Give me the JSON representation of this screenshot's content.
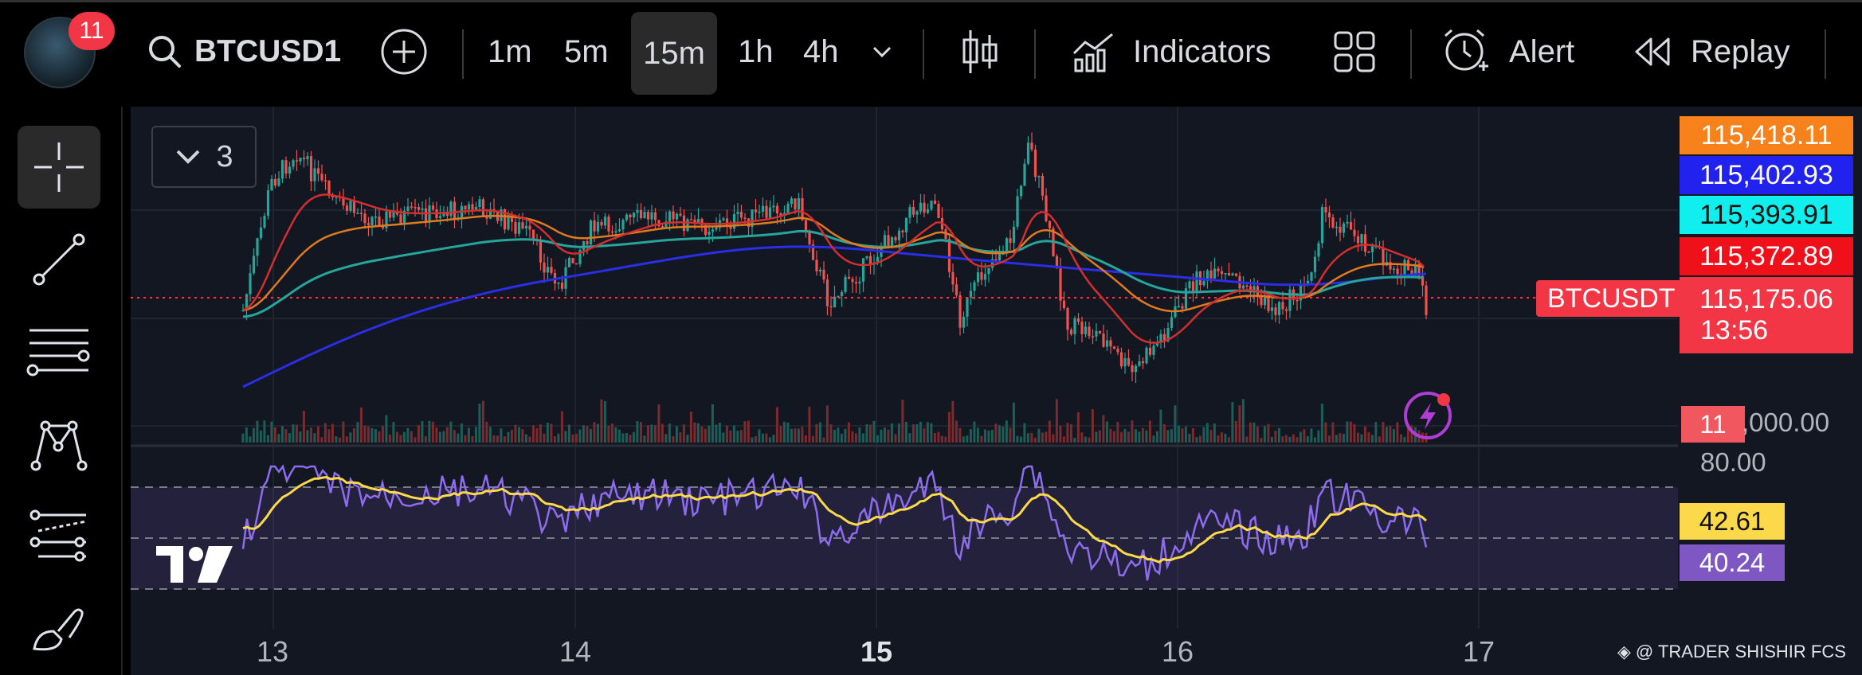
{
  "toolbar": {
    "notification_count": "11",
    "symbol": "BTCUSD1",
    "timeframes": [
      "1m",
      "5m",
      "15m",
      "1h",
      "4h"
    ],
    "active_timeframe": "15m",
    "indicators_label": "Indicators",
    "alert_label": "Alert",
    "replay_label": "Replay"
  },
  "legend": {
    "count": "3"
  },
  "price_scale": {
    "ma_orange": "115,418.11",
    "ma_blue": "115,402.93",
    "ma_cyan": "115,393.91",
    "ma_red": "115,372.89",
    "symbol_label": "BTCUSDT",
    "last_price": "115,175.06",
    "countdown": "13:56",
    "volume_badge": "11",
    "volume_value": ",000.00",
    "rsi_top": "80.00",
    "rsi_ma": "42.61",
    "rsi_value": "40.24"
  },
  "time_axis": [
    "13",
    "14",
    "15",
    "16",
    "17"
  ],
  "watermark": "@ TRADER SHISHIR FCS",
  "colors": {
    "orange": "#f7821b",
    "blue": "#2a2ee6",
    "cyan": "#10f0f0",
    "red": "#f23645",
    "yellow": "#fbd94b",
    "purple": "#7e57c2"
  }
}
